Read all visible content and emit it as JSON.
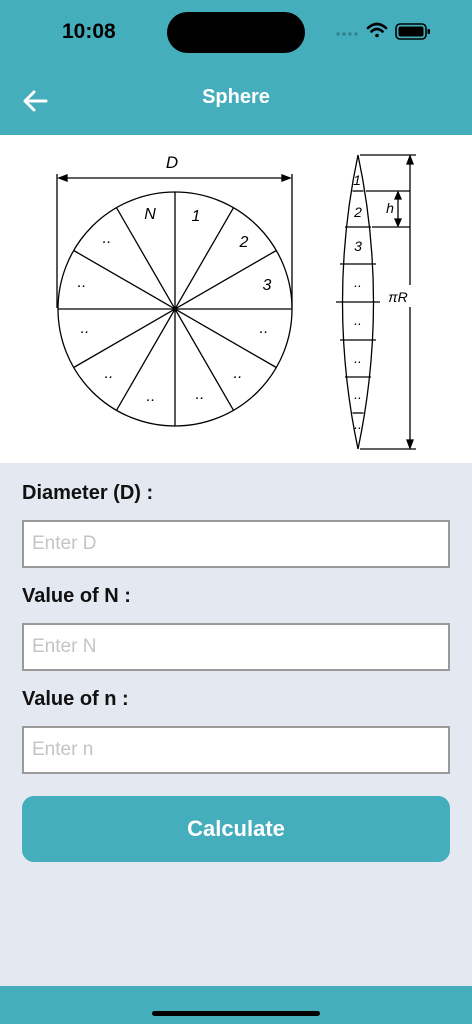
{
  "status_bar": {
    "time": "10:08"
  },
  "header": {
    "title": "Sphere",
    "back_icon": "arrow-left-icon"
  },
  "diagram": {
    "circle_labels": {
      "diameter": "D",
      "segments": [
        "N",
        "1",
        "2",
        "3",
        "..",
        "..",
        "..",
        "..",
        "..",
        "..",
        "..",
        ".."
      ]
    },
    "strip_labels": {
      "gores": [
        "1",
        "2",
        "3",
        "..",
        "..",
        "..",
        "..",
        ".."
      ],
      "height": "h",
      "length": "πR"
    }
  },
  "form": {
    "diameter": {
      "label": "Diameter (D) :",
      "placeholder": "Enter D",
      "value": ""
    },
    "big_n": {
      "label": "Value of N :",
      "placeholder": "Enter N",
      "value": ""
    },
    "small_n": {
      "label": "Value of n :",
      "placeholder": "Enter n",
      "value": ""
    },
    "calculate_label": "Calculate"
  },
  "colors": {
    "accent": "#45aebd",
    "background": "#e3e8f1"
  }
}
